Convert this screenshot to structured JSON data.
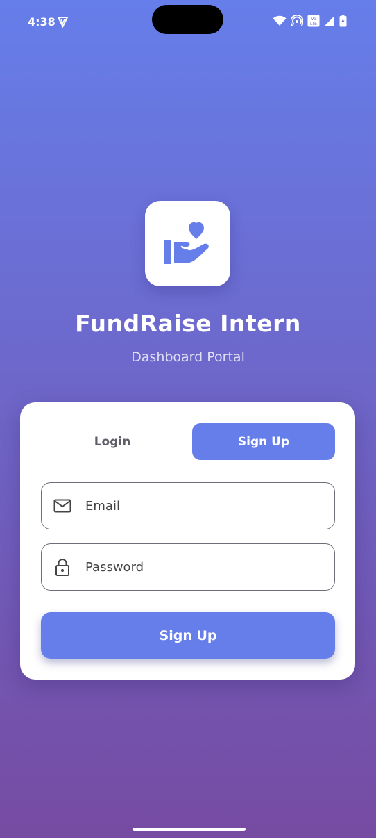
{
  "status_bar": {
    "time": "4:38",
    "icons": [
      "vpn-icon",
      "wifi-icon",
      "hotspot-icon",
      "volte-icon",
      "signal-icon",
      "battery-icon"
    ],
    "volte_label": "Vo LTE"
  },
  "app": {
    "logo_icon": "hand-heart-icon",
    "title": "FundRaise Intern",
    "subtitle": "Dashboard Portal"
  },
  "auth_card": {
    "tabs": [
      {
        "label": "Login",
        "active": false
      },
      {
        "label": "Sign Up",
        "active": true
      }
    ],
    "email": {
      "placeholder": "Email",
      "value": "",
      "icon": "mail-icon"
    },
    "password": {
      "placeholder": "Password",
      "value": "",
      "icon": "lock-icon"
    },
    "submit_label": "Sign Up"
  },
  "colors": {
    "gradient_top": "#667eea",
    "gradient_bottom": "#764ba2",
    "accent": "#667eea",
    "card_bg": "#ffffff"
  }
}
